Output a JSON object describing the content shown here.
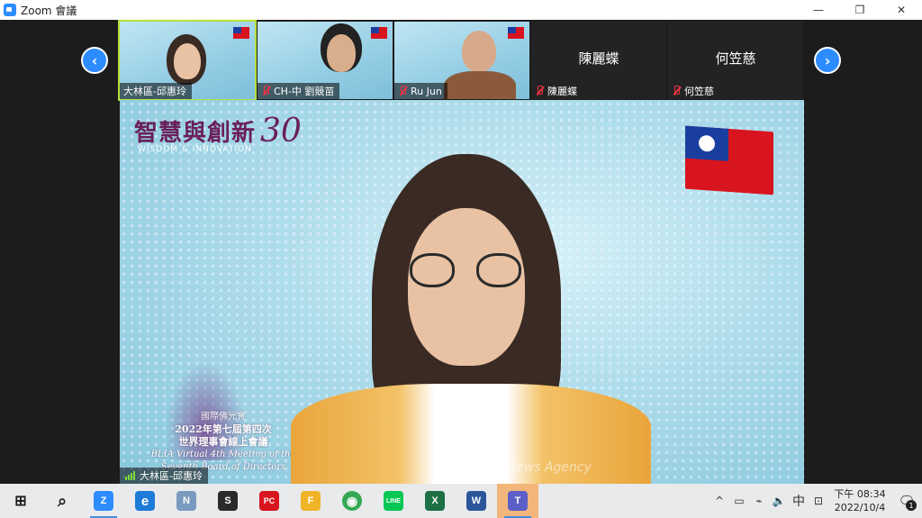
{
  "window": {
    "title": "Zoom 會議",
    "controls": [
      "—",
      "❐",
      "✕"
    ]
  },
  "gallery_strip": {
    "prev_label": "‹",
    "next_label": "›",
    "participants": [
      {
        "name": "大林區-邱惠玲",
        "muted": false,
        "video": true,
        "active_speaker": true
      },
      {
        "name": "CH-中 劉競苗",
        "muted": true,
        "video": true
      },
      {
        "name": "Ru Jun",
        "muted": true,
        "video": true
      },
      {
        "name": "陳麗蝶",
        "muted": true,
        "video": false
      },
      {
        "name": "何笠慈",
        "muted": true,
        "video": false
      }
    ]
  },
  "main_video": {
    "speaker_name": "大林區-邱惠玲",
    "background": {
      "logo_cn": "智慧與創新",
      "logo_en": "WISDOM & INNOVATION",
      "logo_30": "30",
      "banner_line1": "國際佛光會",
      "banner_line2": "2022年第七屆第四次",
      "banner_line3": "世界理事會線上會議",
      "banner_line4": "BLIA Virtual 4th Meeting of the",
      "banner_line5": "Seventh Board of Directors"
    },
    "watermark": "Life News Agency"
  },
  "taskbar": {
    "apps": [
      {
        "name": "windows-start",
        "label": "⊞",
        "color": "#1f1f1f"
      },
      {
        "name": "search",
        "label": "⌕",
        "color": "#1f1f1f"
      },
      {
        "name": "zoom",
        "label": "Z",
        "color": "#2d8cff",
        "active": true
      },
      {
        "name": "internet-explorer",
        "label": "e",
        "color": "#1e7bd8"
      },
      {
        "name": "notes",
        "label": "N",
        "color": "#7a9bbf"
      },
      {
        "name": "sticky",
        "label": "S",
        "color": "#2a2a2a"
      },
      {
        "name": "pchome",
        "label": "PC",
        "color": "#d8141e"
      },
      {
        "name": "file-explorer",
        "label": "F",
        "color": "#f0b429"
      },
      {
        "name": "chrome",
        "label": "◉",
        "color": "#34a853"
      },
      {
        "name": "line",
        "label": "LINE",
        "color": "#06c755"
      },
      {
        "name": "excel",
        "label": "X",
        "color": "#1d7044"
      },
      {
        "name": "word",
        "label": "W",
        "color": "#2b579a"
      },
      {
        "name": "teams",
        "label": "T",
        "color": "#5b5fc7",
        "active": true
      }
    ],
    "tray": {
      "chevron": "^",
      "ime": "中",
      "time": "下午 08:34",
      "date": "2022/10/4",
      "notification_count": "1"
    }
  }
}
